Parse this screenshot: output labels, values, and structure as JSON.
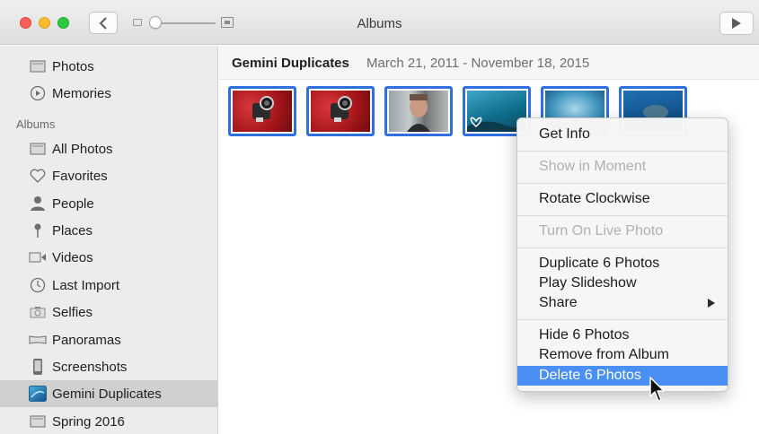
{
  "window": {
    "title": "Albums"
  },
  "sidebar": {
    "section_header": "Albums",
    "items": [
      {
        "label": "Photos",
        "icon": "photos-icon"
      },
      {
        "label": "Memories",
        "icon": "memories-icon"
      },
      {
        "label": "All Photos",
        "icon": "all-photos-icon"
      },
      {
        "label": "Favorites",
        "icon": "heart-icon"
      },
      {
        "label": "People",
        "icon": "person-icon"
      },
      {
        "label": "Places",
        "icon": "pin-icon"
      },
      {
        "label": "Videos",
        "icon": "video-icon"
      },
      {
        "label": "Last Import",
        "icon": "clock-icon"
      },
      {
        "label": "Selfies",
        "icon": "camera-icon"
      },
      {
        "label": "Panoramas",
        "icon": "panorama-icon"
      },
      {
        "label": "Screenshots",
        "icon": "phone-icon"
      },
      {
        "label": "Gemini Duplicates",
        "icon": "album-cover-icon",
        "selected": true
      },
      {
        "label": "Spring 2016",
        "icon": "album-icon"
      }
    ]
  },
  "main": {
    "album_title": "Gemini Duplicates",
    "date_range": "March 21, 2011 - November 18, 2015",
    "selected_count": 6
  },
  "context_menu": {
    "items": [
      {
        "label": "Get Info",
        "enabled": true
      },
      {
        "label": "Show in Moment",
        "enabled": false
      },
      {
        "label": "Rotate Clockwise",
        "enabled": true
      },
      {
        "label": "Turn On Live Photo",
        "enabled": false
      },
      {
        "label": "Duplicate 6 Photos",
        "enabled": true
      },
      {
        "label": "Play Slideshow",
        "enabled": true
      },
      {
        "label": "Share",
        "enabled": true,
        "has_submenu": true
      },
      {
        "label": "Hide 6 Photos",
        "enabled": true
      },
      {
        "label": "Remove from Album",
        "enabled": true
      },
      {
        "label": "Delete 6 Photos",
        "enabled": true,
        "highlighted": true
      }
    ]
  },
  "colors": {
    "selection_border": "#2f6fe0",
    "menu_highlight": "#4a8ff3",
    "sidebar_bg": "#ececec"
  }
}
